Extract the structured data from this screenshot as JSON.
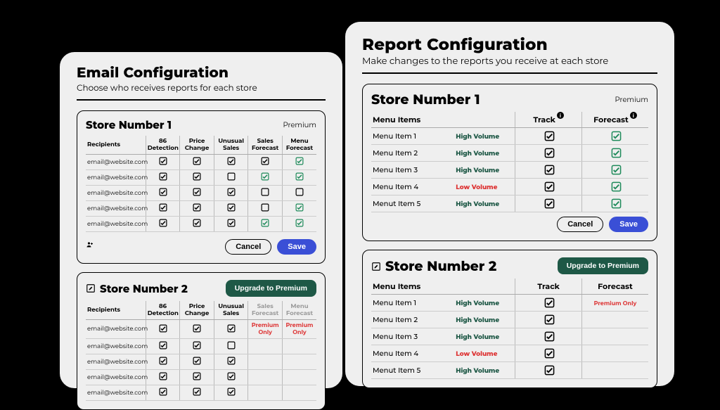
{
  "common": {
    "cancel": "Cancel",
    "save": "Save",
    "upgrade": "Upgrade to Premium",
    "premium_badge": "Premium",
    "premium_only": "Premium Only"
  },
  "email": {
    "title": "Email Configuration",
    "subtitle": "Choose who receives reports for each store",
    "cols": {
      "recipients": "Recipients",
      "c1": "86 Detection",
      "c2": "Price Change",
      "c3": "Unusual Sales",
      "c4": "Sales Forecast",
      "c5": "Menu Forecast"
    },
    "store1": {
      "title": "Store Number 1",
      "rows": [
        {
          "email": "email@website.com",
          "c1": "on",
          "c2": "on",
          "c3": "on",
          "c4": "on",
          "c5": "ong"
        },
        {
          "email": "email@website.com",
          "c1": "on",
          "c2": "on",
          "c3": "off",
          "c4": "ong",
          "c5": "ong"
        },
        {
          "email": "email@website.com",
          "c1": "on",
          "c2": "on",
          "c3": "on",
          "c4": "off",
          "c5": "off"
        },
        {
          "email": "email@website.com",
          "c1": "on",
          "c2": "on",
          "c3": "on",
          "c4": "off",
          "c5": "ong"
        },
        {
          "email": "email@website.com",
          "c1": "on",
          "c2": "on",
          "c3": "on",
          "c4": "ong",
          "c5": "ong"
        }
      ]
    },
    "store2": {
      "title": "Store Number 2",
      "rows": [
        {
          "email": "email@website.com",
          "c1": "on",
          "c2": "on",
          "c3": "on"
        },
        {
          "email": "email@website.com",
          "c1": "on",
          "c2": "on",
          "c3": "off"
        },
        {
          "email": "email@website.com",
          "c1": "on",
          "c2": "on",
          "c3": "on"
        },
        {
          "email": "email@website.com",
          "c1": "on",
          "c2": "on",
          "c3": "on"
        },
        {
          "email": "email@website.com",
          "c1": "on",
          "c2": "on",
          "c3": "on"
        }
      ]
    }
  },
  "report": {
    "title": "Report Configuration",
    "subtitle": "Make changes to the reports you receive at each store",
    "cols": {
      "menu": "Menu Items",
      "track": "Track",
      "forecast": "Forecast"
    },
    "store1": {
      "title": "Store Number 1",
      "rows": [
        {
          "name": "Menu Item 1",
          "vol": "High Volume",
          "vclass": "high",
          "track": "on",
          "forecast": "ong"
        },
        {
          "name": "Menu Item 2",
          "vol": "High Volume",
          "vclass": "high",
          "track": "on",
          "forecast": "ong"
        },
        {
          "name": "Menu Item 3",
          "vol": "High Volume",
          "vclass": "high",
          "track": "on",
          "forecast": "ong"
        },
        {
          "name": "Menu Item 4",
          "vol": "Low Volume",
          "vclass": "low",
          "track": "on",
          "forecast": "ong"
        },
        {
          "name": "Menut Item 5",
          "vol": "High Volume",
          "vclass": "high",
          "track": "on",
          "forecast": "ong"
        }
      ]
    },
    "store2": {
      "title": "Store Number 2",
      "rows": [
        {
          "name": "Menu Item 1",
          "vol": "High Volume",
          "vclass": "high",
          "track": "on"
        },
        {
          "name": "Menu Item 2",
          "vol": "High Volume",
          "vclass": "high",
          "track": "on"
        },
        {
          "name": "Menu Item 3",
          "vol": "High Volume",
          "vclass": "high",
          "track": "on"
        },
        {
          "name": "Menu Item 4",
          "vol": "Low Volume",
          "vclass": "low",
          "track": "on"
        },
        {
          "name": "Menut Item 5",
          "vol": "High Volume",
          "vclass": "high",
          "track": "on"
        }
      ]
    }
  }
}
